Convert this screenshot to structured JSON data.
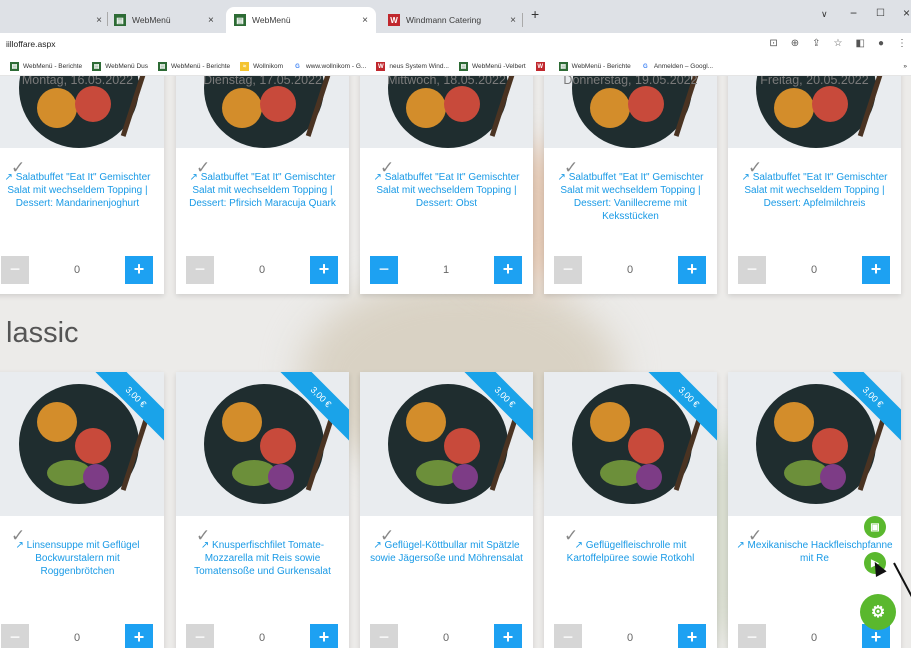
{
  "browser": {
    "tabs": [
      {
        "title": "",
        "has_icon": false
      },
      {
        "title": "WebMenü",
        "has_icon": true,
        "icon": "webmenue-icon"
      },
      {
        "title": "WebMenü",
        "has_icon": true,
        "icon": "webmenue-icon",
        "active": true
      },
      {
        "title": "Windmann Catering",
        "has_icon": true,
        "icon": "windmann-icon"
      }
    ],
    "url": "iilloffare.aspx",
    "bookmarks": [
      "WebMenü - Berichte",
      "WebMenü Dus",
      "WebMenü - Berichte",
      "Wollnikom",
      "www.wollnikom - G...",
      "neus System Wind...",
      "WebMenü -Velbert",
      "",
      "WebMenü - Berichte",
      "Anmelden – Googl..."
    ]
  },
  "page": {
    "section_title": "lassic",
    "row1": [
      {
        "date": "Montag, 16.05.2022",
        "desc": "Salatbuffet \"Eat It\" Gemischter Salat mit wechseldem Topping | Dessert: Mandarinenjoghurt",
        "qty": "0"
      },
      {
        "date": "Dienstag, 17.05.2022",
        "desc": "Salatbuffet \"Eat It\" Gemischter Salat mit wechseldem Topping | Dessert: Pfirsich Maracuja Quark",
        "qty": "0"
      },
      {
        "date": "Mittwoch, 18.05.2022",
        "desc": "Salatbuffet \"Eat It\" Gemischter Salat mit wechseldem Topping | Dessert: Obst",
        "qty": "1"
      },
      {
        "date": "Donnerstag, 19.05.2022",
        "desc": "Salatbuffet \"Eat It\" Gemischter Salat mit wechseldem Topping | Dessert: Vanillecreme mit Keksstücken",
        "qty": "0"
      },
      {
        "date": "Freitag, 20.05.2022",
        "desc": "Salatbuffet \"Eat It\" Gemischter Salat mit wechseldem Topping | Dessert: Apfelmilchreis",
        "qty": "0"
      }
    ],
    "row2": [
      {
        "price": "3,00 €",
        "desc": "Linsensuppe mit Geflügel Bockwurstalern mit Roggenbrötchen",
        "qty": "0"
      },
      {
        "price": "3,00 €",
        "desc": "Knusperfischfilet Tomate-Mozzarella mit Reis sowie Tomatensoße und Gurkensalat",
        "qty": "0"
      },
      {
        "price": "3,00 €",
        "desc": "Geflügel-Köttbullar mit Spätzle sowie Jägersoße und Möhrensalat",
        "qty": "0"
      },
      {
        "price": "3,00 €",
        "desc": "Geflügelfleischrolle mit Kartoffelpüree sowie Rotkohl",
        "qty": "0"
      },
      {
        "price": "3,00 €",
        "desc": "Mexikanische Hackfleischpfanne mit Re",
        "qty": "0"
      }
    ]
  },
  "colors": {
    "accent": "#1da1f2",
    "green": "#5ab82e",
    "minus_active": "#1da1f2",
    "minus_inactive": "#d6d6d6"
  }
}
